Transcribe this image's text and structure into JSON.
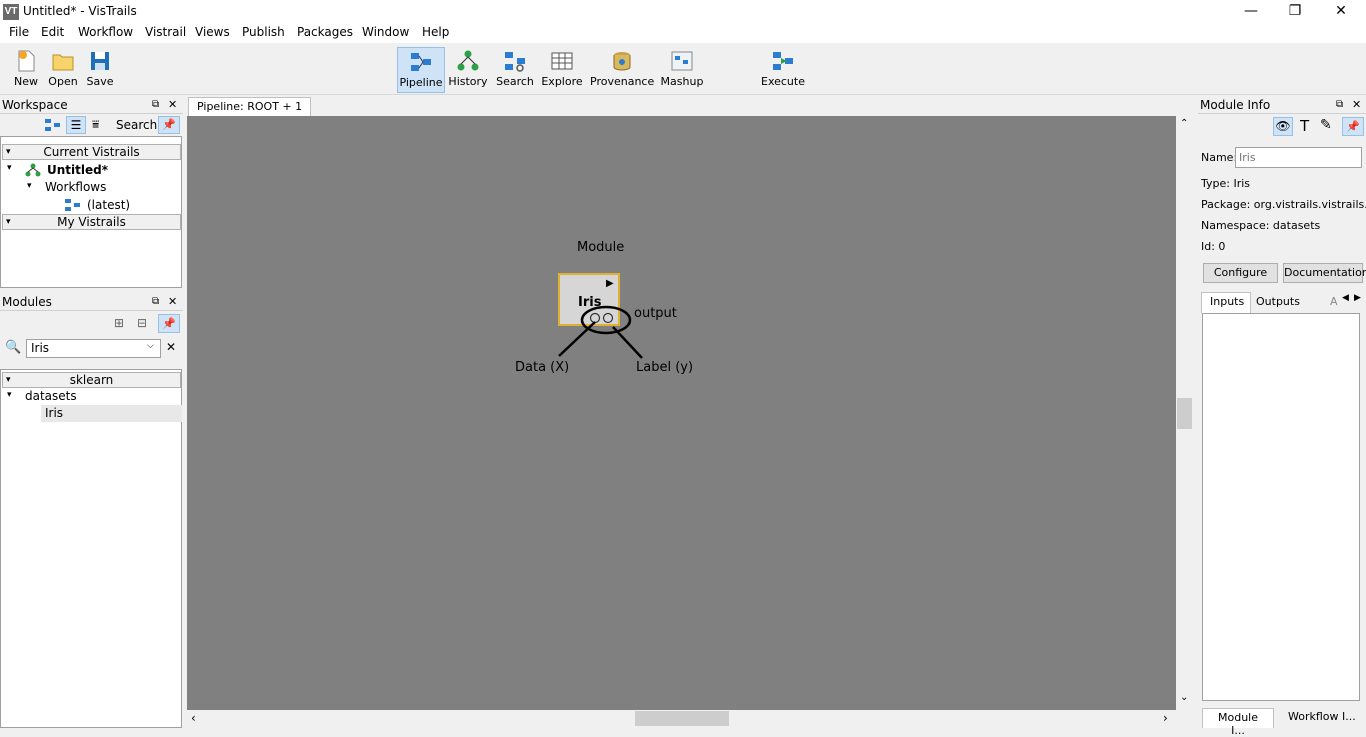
{
  "window": {
    "title": "Untitled* - VisTrails",
    "app_icon": "VT",
    "minimize": "—",
    "maximize": "❐",
    "close": "✕"
  },
  "menu": [
    "File",
    "Edit",
    "Workflow",
    "Vistrail",
    "Views",
    "Publish",
    "Packages",
    "Window",
    "Help"
  ],
  "toolbar": {
    "new": "New",
    "open": "Open",
    "save": "Save",
    "pipeline": "Pipeline",
    "history": "History",
    "search": "Search",
    "explore": "Explore",
    "provenance": "Provenance",
    "mashup": "Mashup",
    "execute": "Execute"
  },
  "workspace": {
    "title": "Workspace",
    "search_label": "Search",
    "current_vistrails": "Current Vistrails",
    "vistrail_name": "Untitled*",
    "workflows": "Workflows",
    "latest": "(latest)",
    "my_vistrails": "My Vistrails"
  },
  "modules_panel": {
    "title": "Modules",
    "search_value": "Iris",
    "package": "sklearn",
    "namespace": "datasets",
    "module": "Iris"
  },
  "pipeline_tab": "Pipeline: ROOT + 1",
  "canvas": {
    "annotation_module": "Module",
    "module_name": "Iris",
    "annotation_output": "output",
    "annotation_data": "Data (X)",
    "annotation_label": "Label (y)"
  },
  "module_info": {
    "title": "Module Info",
    "name_label": "Name:",
    "name_placeholder": "Iris",
    "type": "Type: Iris",
    "package": "Package: org.vistrails.vistrails.sklearn",
    "namespace": "Namespace: datasets",
    "id": "Id: 0",
    "configure": "Configure",
    "documentation": "Documentation",
    "tab_inputs": "Inputs",
    "tab_outputs": "Outputs",
    "tab_annotations": "A"
  },
  "bottom_tabs": {
    "module_info": "Module I...",
    "workflow_info": "Workflow I..."
  },
  "colors": {
    "canvas": "#808080",
    "module_fill": "#d6d6d6",
    "module_border": "#e0b030",
    "accent": "#cfe3f7"
  }
}
